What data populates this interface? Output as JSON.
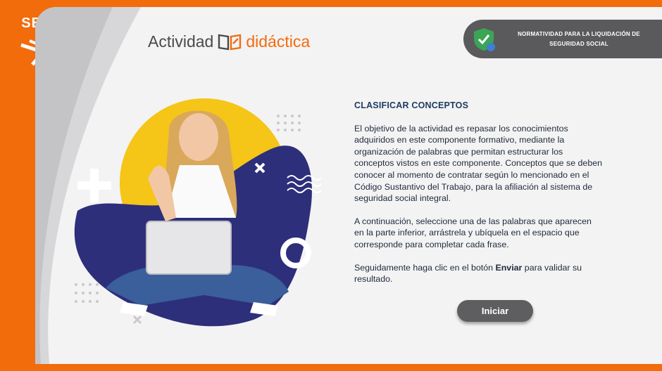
{
  "logo": {
    "text": "SENA"
  },
  "brand": {
    "part1": "Actividad",
    "part2": "didáctica"
  },
  "badge": {
    "line1": "NORMATIVIDAD PARA LA LIQUIDACIÓN DE",
    "line2": "SEGURIDAD SOCIAL"
  },
  "content": {
    "title": "CLASIFICAR CONCEPTOS",
    "p1": "El objetivo de la actividad es repasar los conocimientos adquiridos en este componente formativo, mediante la organización de palabras que permitan estructurar los conceptos vistos en este componente. Conceptos que se deben conocer al momento de contratar según lo mencionado en el Código Sustantivo del Trabajo, para la afiliación al sistema de seguridad social integral.",
    "p2": "A continuación, seleccione una de las palabras que aparecen en la parte inferior, arrástrela y ubíquela en el espacio que corresponde para completar cada frase.",
    "p3_before": "Seguidamente haga clic en el botón ",
    "p3_bold": "Enviar",
    "p3_after": " para validar su resultado."
  },
  "button": {
    "label": "Iniciar"
  },
  "colors": {
    "orange": "#f26c0c",
    "navy": "#2d2f7a",
    "yellow": "#f5c518",
    "gray": "#5e5e60"
  }
}
